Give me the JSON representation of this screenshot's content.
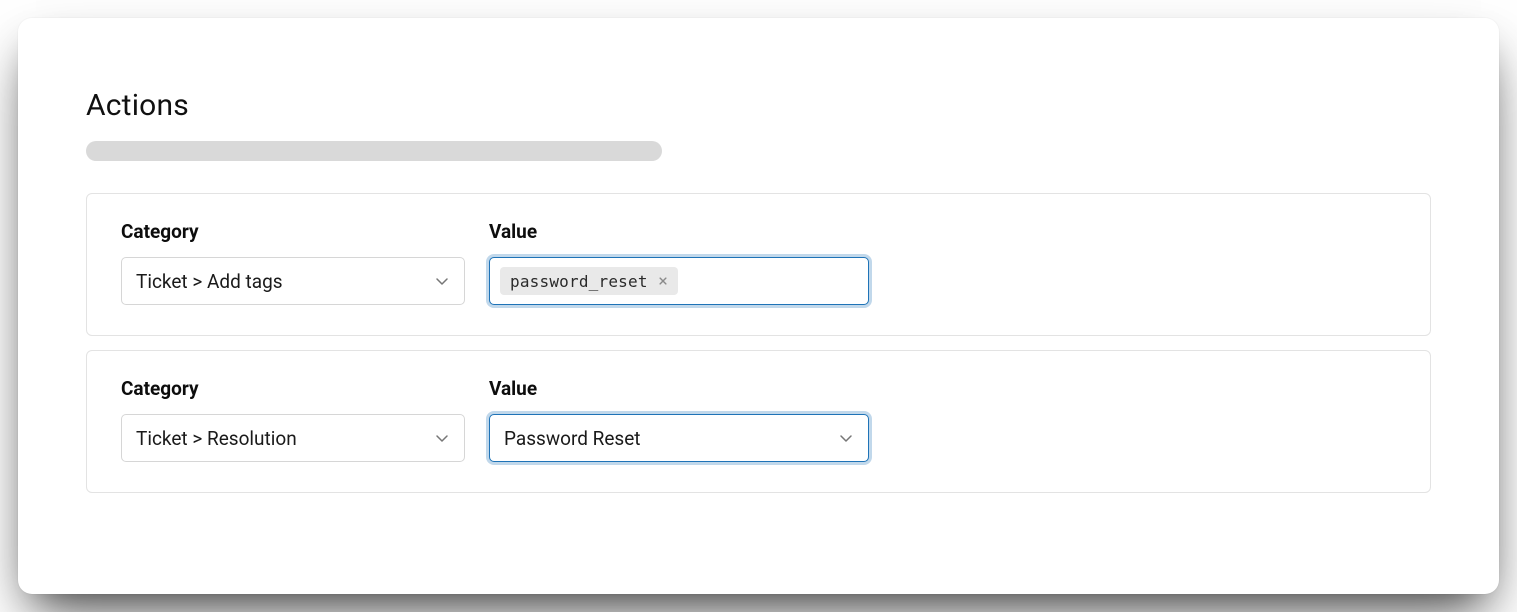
{
  "title": "Actions",
  "labels": {
    "category": "Category",
    "value": "Value"
  },
  "actions": [
    {
      "category": "Ticket > Add tags",
      "value_type": "tags",
      "tags": [
        "password_reset"
      ]
    },
    {
      "category": "Ticket > Resolution",
      "value_type": "select",
      "value": "Password Reset"
    }
  ]
}
